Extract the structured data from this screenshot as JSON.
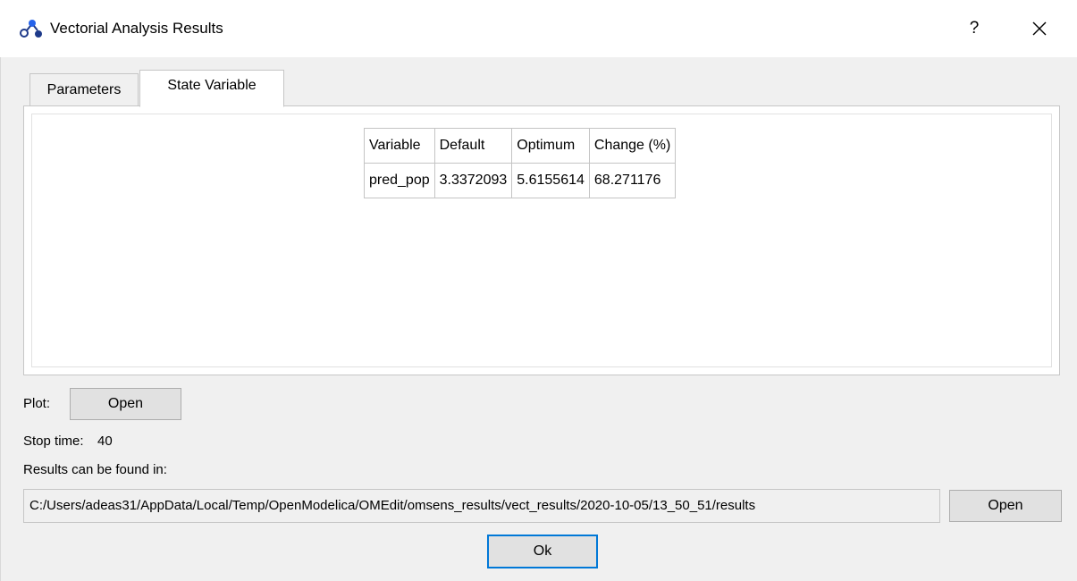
{
  "window": {
    "title": "Vectorial Analysis Results",
    "help_label": "?",
    "icon": "app-icon"
  },
  "tabs": [
    {
      "label": "Parameters",
      "active": false
    },
    {
      "label": "State Variable",
      "active": true
    }
  ],
  "table": {
    "headers": [
      "Variable",
      "Default",
      "Optimum",
      "Change (%)"
    ],
    "rows": [
      [
        "pred_pop",
        "3.3372093",
        "5.6155614",
        "68.271176"
      ]
    ]
  },
  "plot": {
    "label": "Plot:",
    "open_label": "Open"
  },
  "stop_time": {
    "label": "Stop time:",
    "value": "40"
  },
  "results": {
    "label": "Results can be found in:",
    "path": "C:/Users/adeas31/AppData/Local/Temp/OpenModelica/OMEdit/omsens_results/vect_results/2020-10-05/13_50_51/results",
    "open_label": "Open"
  },
  "ok_label": "Ok",
  "colors": {
    "window_bg": "#f0f0f0",
    "titlebar_bg": "#ffffff",
    "focus_border": "#0078d7",
    "button_bg": "#e1e1e1"
  }
}
